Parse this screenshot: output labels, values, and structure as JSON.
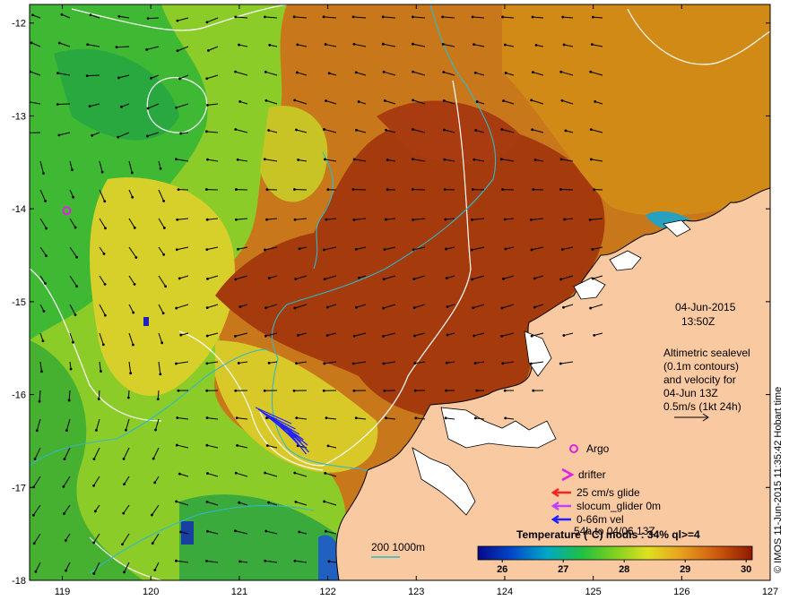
{
  "map": {
    "date_label": "04-Jun-2015",
    "time_label": "13:50Z",
    "info_lines": [
      "Altimetric sealevel",
      "(0.1m contours)",
      "and velocity for",
      "04-Jun 13Z",
      "0.5m/s (1kt 24h)"
    ],
    "lon_ticks": [
      119,
      120,
      121,
      122,
      123,
      124,
      125,
      126,
      127
    ],
    "lat_ticks": [
      -12,
      -13,
      -14,
      -15,
      -16,
      -17,
      -18
    ],
    "lon_range": [
      118.63,
      127
    ],
    "lat_range": [
      -11.8,
      -18
    ],
    "legend": {
      "argo": "Argo",
      "drifter": "drifter",
      "glide25": "25 cm/s glide",
      "slocum": "slocum_glider 0m",
      "vel": "0-66m vel",
      "vel_date": "54h to 04/06 13Z"
    },
    "depth_label": "200  1000m",
    "colorbar": {
      "title": "Temperature (°C) modis : 34% ql>=4",
      "ticks": [
        26,
        27,
        28,
        29,
        30
      ],
      "range": [
        25.6,
        30.1
      ]
    },
    "argo_position": {
      "lon": 119.05,
      "lat": -14.02
    },
    "credit": "© IMOS 11-Jun-2015 11:35:42 Hobart time",
    "colors": {
      "land": "#f9c9a2",
      "warm": "#a83a0c",
      "cool": "#3aa83a",
      "argo": "#e020e0",
      "glider": "#ff2020",
      "slocum": "#c040ff",
      "vel": "#2020ff",
      "contour": "#ffffff",
      "isobath": "#30b8c8"
    }
  }
}
